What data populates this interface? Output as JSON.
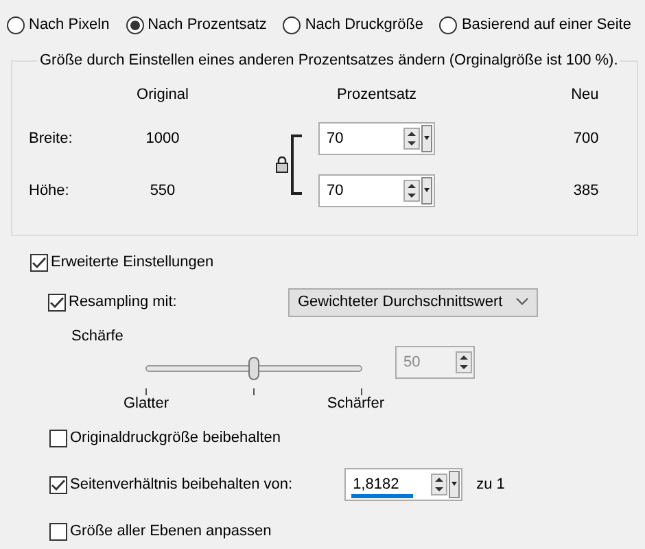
{
  "radios": [
    {
      "label": "Nach Pixeln",
      "selected": false
    },
    {
      "label": "Nach Prozentsatz",
      "selected": true
    },
    {
      "label": "Nach Druckgröße",
      "selected": false
    },
    {
      "label": "Basierend auf einer Seite",
      "selected": false
    }
  ],
  "group": {
    "legend": "Größe durch Einstellen eines anderen Prozentsatzes ändern (Orginalgröße ist 100 %).",
    "columns": [
      "Original",
      "Prozentsatz",
      "Neu"
    ],
    "linked": true,
    "rows": [
      {
        "label": "Breite:",
        "original": "1000",
        "percent": "70",
        "new": "700"
      },
      {
        "label": "Höhe:",
        "original": "550",
        "percent": "70",
        "new": "385"
      }
    ]
  },
  "advanced": {
    "label": "Erweiterte Einstellungen",
    "checked": true
  },
  "resampling": {
    "label": "Resampling mit:",
    "checked": true,
    "method": "Gewichteter Durchschnittswert"
  },
  "sharpness": {
    "label": "Schärfe",
    "level": 0.5,
    "min_label": "Glatter",
    "max_label": "Schärfer",
    "value": "50",
    "disabled": true
  },
  "options": [
    {
      "kind": "checkbox",
      "label": "Originaldruckgröße beibehalten",
      "checked": false
    },
    {
      "kind": "ratio",
      "label": "Seitenverhältnis beibehalten von:",
      "checked": true,
      "value": "1,8182",
      "suffix": "zu 1"
    },
    {
      "kind": "checkbox",
      "label": "Größe aller Ebenen anpassen",
      "checked": false
    }
  ]
}
